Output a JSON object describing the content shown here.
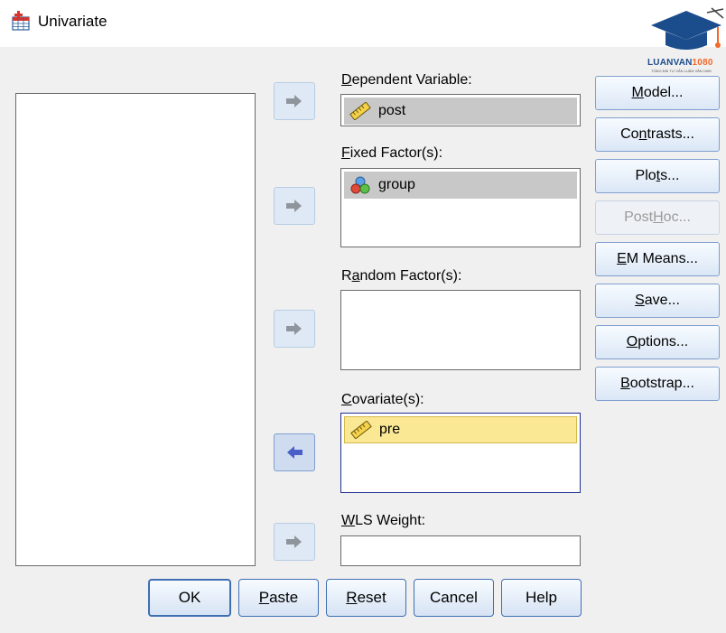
{
  "window": {
    "title": "Univariate"
  },
  "labels": {
    "dependent": "Dependent Variable:",
    "fixed": "Fixed Factor(s):",
    "random": "Random Factor(s):",
    "covariates": "Covariate(s):",
    "wls": "WLS Weight:"
  },
  "dependent_variable": {
    "value": "post",
    "icon": "scale-ruler-icon"
  },
  "fixed_factors": [
    {
      "label": "group",
      "icon": "nominal-circles-icon"
    }
  ],
  "random_factors": [],
  "covariates": [
    {
      "label": "pre",
      "icon": "scale-ruler-icon"
    }
  ],
  "wls_weight": "",
  "side_buttons": [
    {
      "label": "Model...",
      "enabled": true
    },
    {
      "label": "Contrasts...",
      "enabled": true
    },
    {
      "label": "Plots...",
      "enabled": true
    },
    {
      "label": "Post Hoc...",
      "enabled": false
    },
    {
      "label": "EM Means...",
      "enabled": true
    },
    {
      "label": "Save...",
      "enabled": true
    },
    {
      "label": "Options...",
      "enabled": true
    },
    {
      "label": "Bootstrap...",
      "enabled": true
    }
  ],
  "bottom_buttons": {
    "ok": "OK",
    "paste": "Paste",
    "reset": "Reset",
    "cancel": "Cancel",
    "help": "Help"
  },
  "watermark": {
    "brand_main": "LUANVAN",
    "brand_accent": "1080",
    "tagline": "TỔNG ĐÀI TƯ VẤN LUẬN VĂN 1080"
  },
  "colors": {
    "button_border": "#7f9fcf",
    "selection_yellow": "#fbe894",
    "selection_gray": "#c8c8c8",
    "logo_blue": "#1b4c8c",
    "logo_orange": "#f2692a"
  }
}
